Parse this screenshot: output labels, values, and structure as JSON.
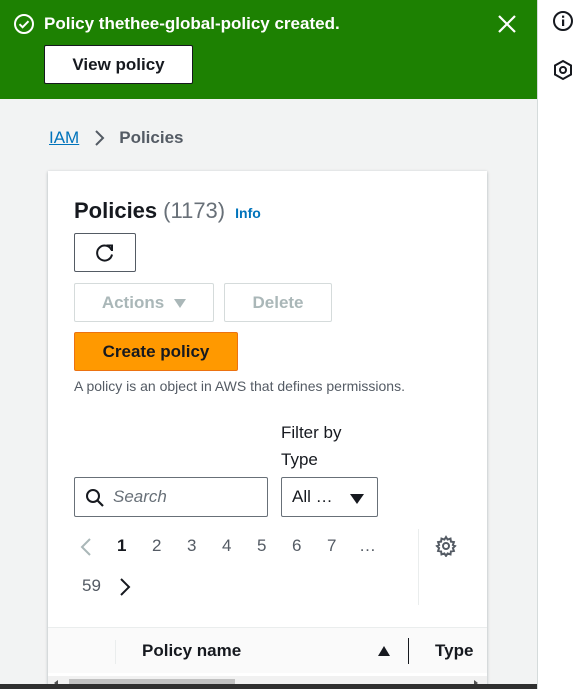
{
  "flash": {
    "message": "Policy thethee-global-policy created.",
    "view_button": "View policy",
    "color": "#1d8102"
  },
  "rail": {
    "icons": [
      "info-icon",
      "settings-hexagon-icon"
    ]
  },
  "breadcrumb": {
    "root": "IAM",
    "current": "Policies"
  },
  "policies": {
    "title": "Policies",
    "count": "(1173)",
    "info_link": "Info",
    "refresh_icon": "refresh-icon",
    "actions_label": "Actions",
    "delete_label": "Delete",
    "create_label": "Create policy",
    "description": "A policy is an object in AWS that defines permissions.",
    "filter_label": "Filter by Type",
    "search_placeholder": "Search",
    "type_select_value": "All …",
    "pages": [
      "1",
      "2",
      "3",
      "4",
      "5",
      "6",
      "7",
      "…"
    ],
    "last_page": "59",
    "current_page": "1",
    "columns": {
      "name": "Policy name",
      "type": "Type"
    },
    "accent_color": "#ff9900",
    "link_color": "#0073bb"
  }
}
